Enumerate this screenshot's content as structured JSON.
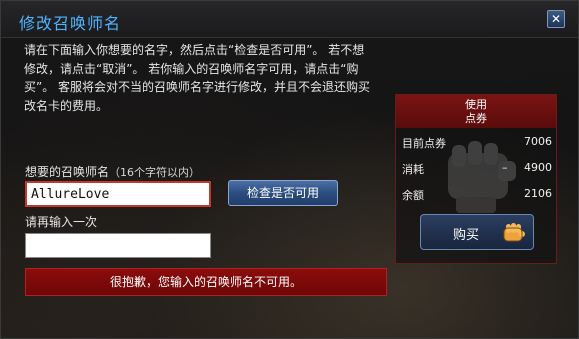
{
  "dialog": {
    "title": "修改召唤师名",
    "close_glyph": "✕"
  },
  "intro_text": "请在下面输入你想要的名字，然后点击“检查是否可用”。 若不想修改，请点击“取消”。 若你输入的召唤师名字可用，请点击“购买”。 客服将会对不当的召唤师名字进行修改，并且不会退还购买改名卡的费用。",
  "form": {
    "name_label": "想要的召唤师名",
    "name_hint": "（16个字符以内）",
    "name_value": "AllureLove",
    "check_button": "检查是否可用",
    "retype_label": "请再输入一次",
    "retype_value": "",
    "error_message": "很抱歉，您输入的召唤师名不可用。"
  },
  "points_panel": {
    "header_line1": "使用",
    "header_line2": "点券",
    "rows": [
      {
        "label": "目前点券",
        "sign": "",
        "value": "7006"
      },
      {
        "label": "消耗",
        "sign": "–",
        "value": "4900"
      },
      {
        "label": "余额",
        "sign": "",
        "value": "2106"
      }
    ],
    "buy_button": "购买",
    "background_icon": "fist-icon",
    "buy_icon": "hand-pointer-icon"
  },
  "colors": {
    "title": "#4fb3ff",
    "error_banner": "#8c0c0c",
    "panel_header": "#7a1414",
    "input_error_border": "#c0392b"
  }
}
